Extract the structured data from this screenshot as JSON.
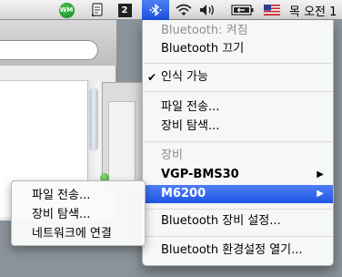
{
  "menubar": {
    "wm_badge": "WM",
    "number_box": "2",
    "clock": "목 오전 1"
  },
  "bluetooth_menu": {
    "status": "Bluetooth: 켜짐",
    "toggle": "Bluetooth 끄기",
    "discoverable": "인식 가능",
    "discoverable_checked": true,
    "send_file": "파일 전송...",
    "browse_device": "장비 탐색...",
    "devices_header": "장비",
    "devices": [
      {
        "name": "VGP-BMS30",
        "selected": false
      },
      {
        "name": "M6200",
        "selected": true
      }
    ],
    "setup_device": "Bluetooth 장비 설정...",
    "open_preferences": "Bluetooth 환경설정 열기..."
  },
  "device_submenu": {
    "items": [
      "파일 전송...",
      "장비 탐색...",
      "네트워크에 연결"
    ]
  },
  "colors": {
    "highlight": "#2f63ea",
    "menubar_highlight": "#3568ea"
  },
  "icons": [
    "wm-badge-icon",
    "script-icon",
    "bluetooth-icon",
    "wifi-icon",
    "volume-icon",
    "battery-icon",
    "us-flag-icon",
    "checkmark-icon",
    "submenu-arrow-icon"
  ]
}
